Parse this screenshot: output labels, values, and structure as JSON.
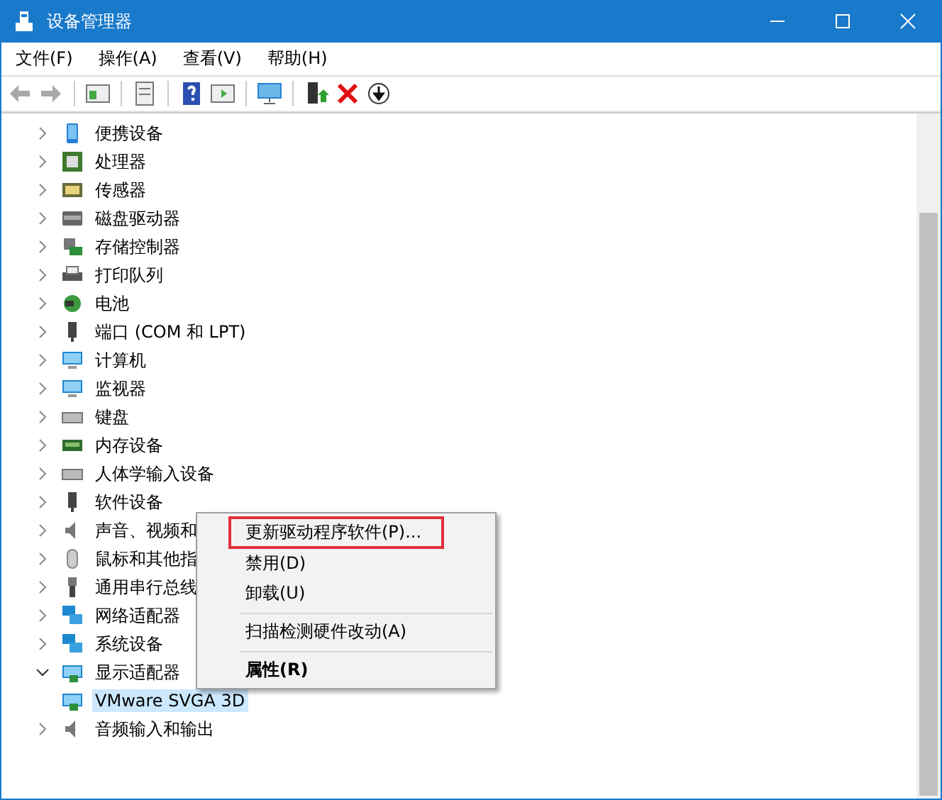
{
  "window": {
    "title": "设备管理器"
  },
  "menu_bar": [
    "文件(F)",
    "操作(A)",
    "查看(V)",
    "帮助(H)"
  ],
  "toolbar": [
    {
      "kind": "back",
      "disabled": true
    },
    {
      "kind": "forward",
      "disabled": true
    },
    {
      "kind": "sep"
    },
    {
      "kind": "panel"
    },
    {
      "kind": "sep"
    },
    {
      "kind": "page"
    },
    {
      "kind": "sep"
    },
    {
      "kind": "help"
    },
    {
      "kind": "run"
    },
    {
      "kind": "sep"
    },
    {
      "kind": "monitor"
    },
    {
      "kind": "sep"
    },
    {
      "kind": "update"
    },
    {
      "kind": "remove"
    },
    {
      "kind": "download"
    }
  ],
  "tree": {
    "items": [
      {
        "label": "便携设备",
        "expanded": false,
        "selected": false
      },
      {
        "label": "处理器",
        "expanded": false,
        "selected": false
      },
      {
        "label": "传感器",
        "expanded": false,
        "selected": false
      },
      {
        "label": "磁盘驱动器",
        "expanded": false,
        "selected": false
      },
      {
        "label": "存储控制器",
        "expanded": false,
        "selected": false
      },
      {
        "label": "打印队列",
        "expanded": false,
        "selected": false
      },
      {
        "label": "电池",
        "expanded": false,
        "selected": false
      },
      {
        "label": "端口 (COM 和 LPT)",
        "expanded": false,
        "selected": false
      },
      {
        "label": "计算机",
        "expanded": false,
        "selected": false
      },
      {
        "label": "监视器",
        "expanded": false,
        "selected": false
      },
      {
        "label": "键盘",
        "expanded": false,
        "selected": false
      },
      {
        "label": "内存设备",
        "expanded": false,
        "selected": false
      },
      {
        "label": "人体学输入设备",
        "expanded": false,
        "selected": false
      },
      {
        "label": "软件设备",
        "expanded": false,
        "selected": false
      },
      {
        "label": "声音、视频和",
        "expanded": false,
        "selected": false
      },
      {
        "label": "鼠标和其他指",
        "expanded": false,
        "selected": false
      },
      {
        "label": "通用串行总线",
        "expanded": false,
        "selected": false
      },
      {
        "label": "网络适配器",
        "expanded": false,
        "selected": false
      },
      {
        "label": "系统设备",
        "expanded": false,
        "selected": false
      },
      {
        "label": "显示适配器",
        "expanded": true,
        "selected": false,
        "children": [
          {
            "label": "VMware SVGA 3D",
            "selected": true
          }
        ]
      },
      {
        "label": "音频输入和输出",
        "expanded": false,
        "selected": false
      }
    ]
  },
  "context_menu": [
    {
      "kind": "item",
      "label": "更新驱动程序软件(P)...",
      "highlighted": true,
      "default": false
    },
    {
      "kind": "item",
      "label": "禁用(D)",
      "highlighted": false,
      "default": false
    },
    {
      "kind": "item",
      "label": "卸载(U)",
      "highlighted": false,
      "default": false
    },
    {
      "kind": "separator"
    },
    {
      "kind": "item",
      "label": "扫描检测硬件改动(A)",
      "highlighted": false,
      "default": false
    },
    {
      "kind": "separator"
    },
    {
      "kind": "item",
      "label": "属性(R)",
      "highlighted": false,
      "default": true
    }
  ]
}
